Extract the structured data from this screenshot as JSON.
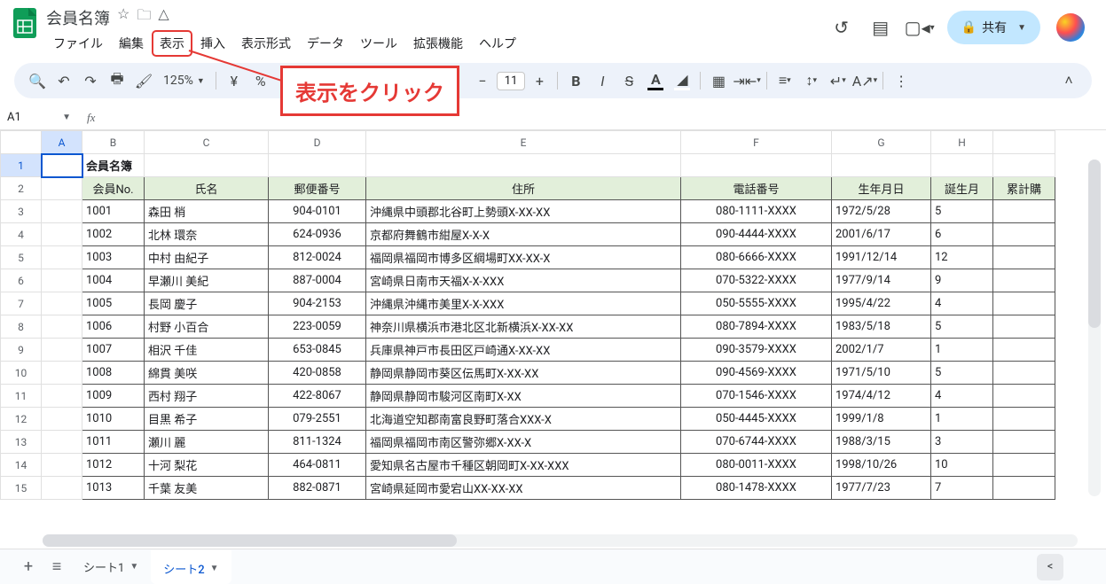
{
  "doc_title": "会員名簿",
  "menus": [
    "ファイル",
    "編集",
    "表示",
    "挿入",
    "表示形式",
    "データ",
    "ツール",
    "拡張機能",
    "ヘルプ"
  ],
  "highlighted_menu_index": 2,
  "callout_text": "表示をクリック",
  "share_label": "共有",
  "zoom": "125%",
  "font_size": "11",
  "name_box": "A1",
  "columns": [
    "A",
    "B",
    "C",
    "D",
    "E",
    "F",
    "G",
    "H"
  ],
  "last_col_visible_partial": "累計購",
  "row_count_visible": 15,
  "table_title": "会員名簿",
  "headers": [
    "会員No.",
    "氏名",
    "郵便番号",
    "住所",
    "電話番号",
    "生年月日",
    "誕生月"
  ],
  "rows": [
    {
      "no": "1001",
      "name": "森田 梢",
      "zip": "904-0101",
      "addr": "沖縄県中頭郡北谷町上勢頭X-XX-XX",
      "tel": "080-1111-XXXX",
      "dob": "1972/5/28",
      "month": "5"
    },
    {
      "no": "1002",
      "name": "北林 環奈",
      "zip": "624-0936",
      "addr": "京都府舞鶴市紺屋X-X-X",
      "tel": "090-4444-XXXX",
      "dob": "2001/6/17",
      "month": "6"
    },
    {
      "no": "1003",
      "name": "中村 由紀子",
      "zip": "812-0024",
      "addr": "福岡県福岡市博多区綱場町XX-XX-X",
      "tel": "080-6666-XXXX",
      "dob": "1991/12/14",
      "month": "12"
    },
    {
      "no": "1004",
      "name": "早瀬川 美紀",
      "zip": "887-0004",
      "addr": "宮崎県日南市天福X-X-XXX",
      "tel": "070-5322-XXXX",
      "dob": "1977/9/14",
      "month": "9"
    },
    {
      "no": "1005",
      "name": "長岡 慶子",
      "zip": "904-2153",
      "addr": "沖縄県沖縄市美里X-X-XXX",
      "tel": "050-5555-XXXX",
      "dob": "1995/4/22",
      "month": "4"
    },
    {
      "no": "1006",
      "name": "村野 小百合",
      "zip": "223-0059",
      "addr": "神奈川県横浜市港北区北新横浜X-XX-XX",
      "tel": "080-7894-XXXX",
      "dob": "1983/5/18",
      "month": "5"
    },
    {
      "no": "1007",
      "name": "相沢 千佳",
      "zip": "653-0845",
      "addr": "兵庫県神戸市長田区戸崎通X-XX-XX",
      "tel": "090-3579-XXXX",
      "dob": "2002/1/7",
      "month": "1"
    },
    {
      "no": "1008",
      "name": "綿貫 美咲",
      "zip": "420-0858",
      "addr": "静岡県静岡市葵区伝馬町X-XX-XX",
      "tel": "090-4569-XXXX",
      "dob": "1971/5/10",
      "month": "5"
    },
    {
      "no": "1009",
      "name": "西村 翔子",
      "zip": "422-8067",
      "addr": "静岡県静岡市駿河区南町X-XX",
      "tel": "070-1546-XXXX",
      "dob": "1974/4/12",
      "month": "4"
    },
    {
      "no": "1010",
      "name": "目黒 希子",
      "zip": "079-2551",
      "addr": "北海道空知郡南富良野町落合XXX-X",
      "tel": "050-4445-XXXX",
      "dob": "1999/1/8",
      "month": "1"
    },
    {
      "no": "1011",
      "name": "瀬川 麗",
      "zip": "811-1324",
      "addr": "福岡県福岡市南区警弥郷X-XX-X",
      "tel": "070-6744-XXXX",
      "dob": "1988/3/15",
      "month": "3"
    },
    {
      "no": "1012",
      "name": "十河 梨花",
      "zip": "464-0811",
      "addr": "愛知県名古屋市千種区朝岡町X-XX-XXX",
      "tel": "080-0011-XXXX",
      "dob": "1998/10/26",
      "month": "10"
    },
    {
      "no": "1013",
      "name": "千葉 友美",
      "zip": "882-0871",
      "addr": "宮崎県延岡市愛宕山XX-XX-XX",
      "tel": "080-1478-XXXX",
      "dob": "1977/7/23",
      "month": "7"
    }
  ],
  "sheet_tabs": [
    {
      "label": "シート1",
      "active": false
    },
    {
      "label": "シート2",
      "active": true
    }
  ]
}
